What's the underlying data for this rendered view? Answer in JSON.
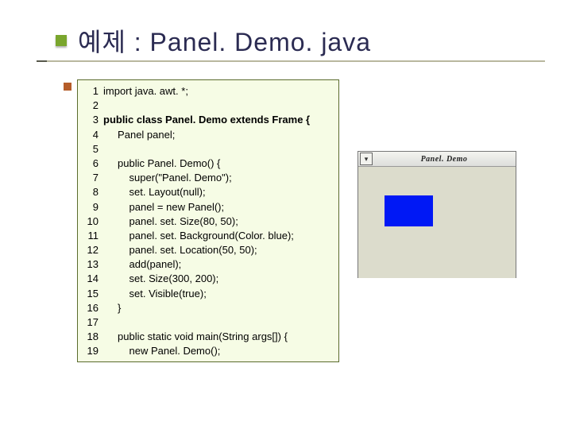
{
  "title": "예제 : Panel. Demo. java",
  "code": {
    "lines": [
      {
        "n": "1",
        "t": "import java. awt. *;"
      },
      {
        "n": "2",
        "t": ""
      },
      {
        "n": "3",
        "t": "public class Panel. Demo extends Frame {",
        "bold": true
      },
      {
        "n": "4",
        "t": "     Panel panel;"
      },
      {
        "n": "5",
        "t": ""
      },
      {
        "n": "6",
        "t": "     public Panel. Demo() {"
      },
      {
        "n": "7",
        "t": "         super(\"Panel. Demo\");"
      },
      {
        "n": "8",
        "t": "         set. Layout(null);"
      },
      {
        "n": "9",
        "t": "         panel = new Panel();"
      },
      {
        "n": "10",
        "t": "         panel. set. Size(80, 50);"
      },
      {
        "n": "11",
        "t": "         panel. set. Background(Color. blue);"
      },
      {
        "n": "12",
        "t": "         panel. set. Location(50, 50);"
      },
      {
        "n": "13",
        "t": "         add(panel);"
      },
      {
        "n": "14",
        "t": "         set. Size(300, 200);"
      },
      {
        "n": "15",
        "t": "         set. Visible(true);"
      },
      {
        "n": "16",
        "t": "     }"
      },
      {
        "n": "17",
        "t": ""
      },
      {
        "n": "18",
        "t": "     public static void main(String args[]) {"
      },
      {
        "n": "19",
        "t": "         new Panel. Demo();"
      }
    ]
  },
  "demo_window": {
    "sys_glyph": "▾",
    "title": "Panel. Demo",
    "panel_color": "#0018f5"
  }
}
